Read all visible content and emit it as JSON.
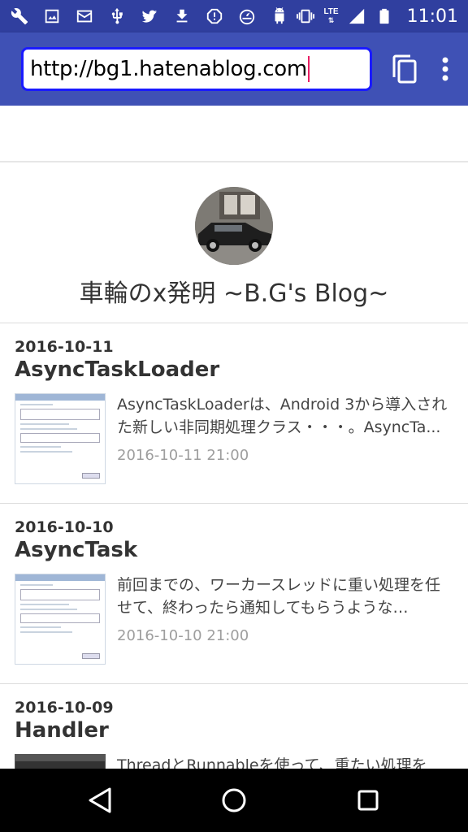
{
  "status_bar": {
    "icons": [
      "wrench-icon",
      "image-icon",
      "mail-icon",
      "usb-icon",
      "twitter-icon",
      "download-icon",
      "alert-shield-icon",
      "speedometer-icon",
      "android-icon"
    ],
    "right_icons": [
      "vibrate-icon",
      "signal-icon",
      "battery-icon"
    ],
    "network": "LTE",
    "time": "11:01"
  },
  "browser": {
    "url": "http://bg1.hatenablog.com",
    "tabs_icon": "tabs-icon",
    "menu_icon": "overflow-menu-icon"
  },
  "blog": {
    "title": "車輪のx発明 ~B.G's Blog~"
  },
  "entries": [
    {
      "date": "2016-10-11",
      "title": "AsyncTaskLoader",
      "summary": "AsyncTaskLoaderは、Android 3から導入された新しい非同期処理クラス・・・。AsyncTa...",
      "time": "2016-10-11 21:00"
    },
    {
      "date": "2016-10-10",
      "title": "AsyncTask",
      "summary": "前回までの、ワーカースレッドに重い処理を任せて、終わったら通知してもらうような…",
      "time": "2016-10-10 21:00"
    },
    {
      "date": "2016-10-09",
      "title": "Handler",
      "summary": "ThreadとRunnableを使って、重たい処理を",
      "time": ""
    }
  ],
  "navbar": {
    "back": "back-icon",
    "home": "home-icon",
    "recents": "recents-icon"
  },
  "colors": {
    "status_bar": "#303f9f",
    "toolbar": "#3f51b5",
    "url_border": "#1a1aff",
    "caret": "#e91e63"
  }
}
